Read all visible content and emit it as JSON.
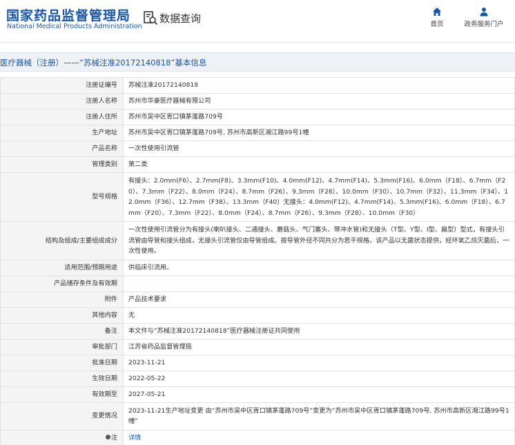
{
  "header": {
    "logo_cn": "国家药品监督管理局",
    "logo_en": "National Medical Products Administration",
    "query_label": "数据查询",
    "nav": [
      {
        "label": "首页",
        "icon": "home-icon"
      },
      {
        "label": "政务服务门户",
        "icon": "user-icon"
      }
    ],
    "brand_color": "#1a56a8"
  },
  "title": "医疗器械（注册）——“苏械注准20172140818”基本信息",
  "rows": [
    {
      "label": "注册证编号",
      "value": "苏械注准20172140818"
    },
    {
      "label": "注册人名称",
      "value": "苏州市华豪医疗器械有限公司"
    },
    {
      "label": "注册人住所",
      "value": "苏州市吴中区胥口镇茅蓬路709号"
    },
    {
      "label": "生产地址",
      "value": "苏州市吴中区胥口镇茅蓬路709号, 苏州市高新区湘江路99号1幢"
    },
    {
      "label": "产品名称",
      "value": "一次性使用引流管"
    },
    {
      "label": "管理类别",
      "value": "第二类"
    },
    {
      "label": "型号规格",
      "value": "有接头：2.0mm(F6）、2.7mm(F8)、3.3mm(F10)、4.0mm(F12)、4.7mm(F14)、5.3mm(F16)、6.0mm（F18）、6.7mm（F20）、7.3mm（F22）、8.0mm（F24）、8.7mm（F26）、9.3mm（F28）、10.0mm（F30）、10.7mm（F32）、11.3mm（F34）、12.0mm（F36）、12.7mm（F38）、13.3mm（F40）无接头：4.0mm(F12)、4.7mm(F14)、5.3mm(F16)、6.0mm（F18）、6.7mm（F20）、7.3mm（F22）、8.0mm（F24）、8.7mm（F26）、9.3mm（F28）、10.0mm（F30）"
    },
    {
      "label": "结构及组成/主要组成成分",
      "value": "一次性使用引流管分为有接头(喇叭接头、二通接头、蘑菇头、气门塞头、带冲水管)和无接头（T型、Y型、I型、扁型）型式，有接头引流管由导管和接头组成，无接头引流管仅由导管组成。按导管外径不同共分为若干规格。该产品以无菌状态提供，经环氧乙烷灭菌后，一次性使用。"
    },
    {
      "label": "适用范围/预期用途",
      "value": "供临床引流用。"
    },
    {
      "label": "产品储存条件及有效期",
      "value": ""
    },
    {
      "label": "附件",
      "value": "产品技术要求"
    },
    {
      "label": "其他内容",
      "value": "无"
    },
    {
      "label": "备注",
      "value": "本文件与“苏械注准20172140818”医疗器械注册证共同使用"
    },
    {
      "label": "审批部门",
      "value": "江苏省药品监督管理局"
    },
    {
      "label": "批准日期",
      "value": "2023-11-21"
    },
    {
      "label": "生效日期",
      "value": "2022-05-22"
    },
    {
      "label": "有效期至",
      "value": "2027-05-21"
    },
    {
      "label": "变更情况",
      "value": "2023-11-21生产地址变更 由“苏州市吴中区胥口镇茅蓬路709号”变更为“苏州市吴中区胥口镇茅蓬路709号, 苏州市高新区湘江路99号1幢”"
    }
  ],
  "note": {
    "label": "注",
    "link": "详情"
  }
}
